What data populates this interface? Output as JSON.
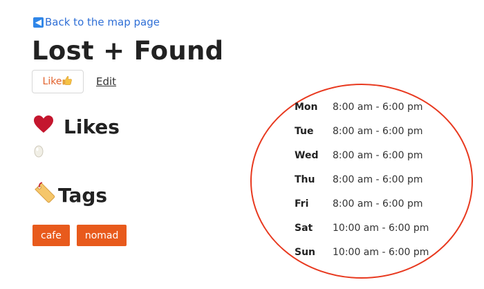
{
  "back_link": {
    "icon": "left-arrow-icon",
    "label": "Back to the map page"
  },
  "title": "Lost + Found",
  "actions": {
    "like_label": "Like",
    "like_icon": "thumbs-up-icon",
    "edit_label": "Edit"
  },
  "likes": {
    "icon": "heart-icon",
    "heading": "Likes"
  },
  "tags": {
    "icon": "tag-icon",
    "heading": "Tags",
    "items": [
      "cafe",
      "nomad"
    ]
  },
  "hours": [
    {
      "day": "Mon",
      "time": "8:00 am - 6:00 pm"
    },
    {
      "day": "Tue",
      "time": "8:00 am - 6:00 pm"
    },
    {
      "day": "Wed",
      "time": "8:00 am - 6:00 pm"
    },
    {
      "day": "Thu",
      "time": "8:00 am - 6:00 pm"
    },
    {
      "day": "Fri",
      "time": "8:00 am - 6:00 pm"
    },
    {
      "day": "Sat",
      "time": "10:00 am - 6:00 pm"
    },
    {
      "day": "Sun",
      "time": "10:00 am - 6:00 pm"
    }
  ],
  "colors": {
    "link": "#2f6fd6",
    "accent": "#e85a1c",
    "annotation_circle": "#e8391f"
  }
}
